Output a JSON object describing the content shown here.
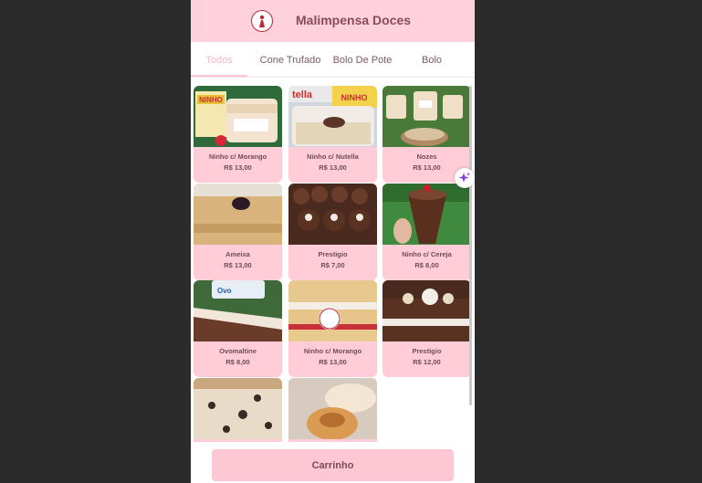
{
  "header": {
    "title": "Malimpensa Doces",
    "logo_icon": "woman-silhouette-logo"
  },
  "tabs": [
    {
      "label": "Todos",
      "active": true
    },
    {
      "label": "Cone Trufado",
      "active": false
    },
    {
      "label": "Bolo De Pote",
      "active": false
    },
    {
      "label": "Bolo",
      "active": false
    }
  ],
  "products": [
    {
      "name": "Ninho c/ Morango",
      "price": "R$ 13,00"
    },
    {
      "name": "Ninho c/ Nutella",
      "price": "R$ 13,00"
    },
    {
      "name": "Nozes",
      "price": "R$ 13,00"
    },
    {
      "name": "Ameixa",
      "price": "R$ 13,00"
    },
    {
      "name": "Prestigio",
      "price": "R$ 7,00"
    },
    {
      "name": "Ninho c/ Cereja",
      "price": "R$ 8,00"
    },
    {
      "name": "Ovomaltine",
      "price": "R$ 8,00"
    },
    {
      "name": "Ninho c/ Morango",
      "price": "R$ 13,00"
    },
    {
      "name": "Prestigio",
      "price": "R$ 12,00"
    },
    {
      "name": "",
      "price": ""
    },
    {
      "name": "",
      "price": ""
    }
  ],
  "photo_labels": {
    "ninho": "NINHO",
    "nutella": "tella",
    "ovomaltine": "Ovo"
  },
  "footer": {
    "cart_label": "Carrinho"
  },
  "colors": {
    "brand_pink": "#ffd1dc",
    "card_pink": "#ffccd7",
    "text": "#6e4d55"
  }
}
